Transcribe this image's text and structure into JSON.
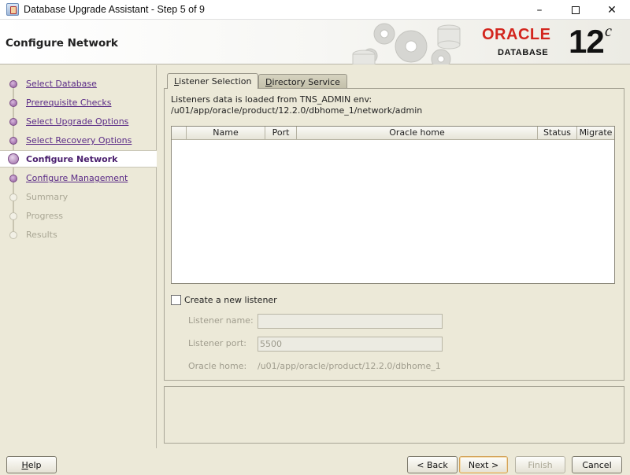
{
  "window": {
    "title": "Database Upgrade Assistant - Step 5 of 9",
    "controls": {
      "minimize": "–",
      "close": "✕"
    }
  },
  "header": {
    "title": "Configure Network",
    "logo_brand": "ORACLE",
    "logo_product": "DATABASE",
    "logo_version": "12",
    "logo_version_suffix": "c"
  },
  "nav": {
    "items": [
      {
        "label": "Select Database",
        "state": "link"
      },
      {
        "label": "Prerequisite Checks",
        "state": "link"
      },
      {
        "label": "Select Upgrade Options",
        "state": "link"
      },
      {
        "label": "Select Recovery Options",
        "state": "link"
      },
      {
        "label": "Configure Network",
        "state": "current"
      },
      {
        "label": "Configure Management",
        "state": "link"
      },
      {
        "label": "Summary",
        "state": "disabled"
      },
      {
        "label": "Progress",
        "state": "disabled"
      },
      {
        "label": "Results",
        "state": "disabled"
      }
    ]
  },
  "tabs": {
    "listener_selection": "Listener Selection",
    "directory_service": "Directory Service"
  },
  "listener_panel": {
    "info_line1": "Listeners data is loaded from TNS_ADMIN env:",
    "info_line2": "/u01/app/oracle/product/12.2.0/dbhome_1/network/admin",
    "table_columns": [
      "Name",
      "Port",
      "Oracle home",
      "Status",
      "Migrate"
    ],
    "create_listener_label": "Create a new listener",
    "listener_name_label": "Listener name:",
    "listener_name_value": "",
    "listener_port_label": "Listener port:",
    "listener_port_value": "5500",
    "oracle_home_label": "Oracle home:",
    "oracle_home_value": "/u01/app/oracle/product/12.2.0/dbhome_1"
  },
  "buttons": {
    "help": "Help",
    "back": "< Back",
    "next": "Next >",
    "finish": "Finish",
    "cancel": "Cancel"
  },
  "colors": {
    "oracle_red": "#d3261e",
    "nav_link": "#5a2a86",
    "background": "#ece9d8"
  }
}
